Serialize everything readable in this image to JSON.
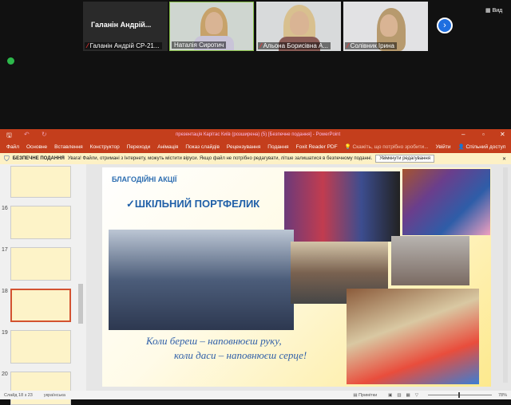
{
  "meeting": {
    "participants": [
      {
        "tile_name": "Галанін Андрій...",
        "label": "Галанін Андрій СР-21..."
      },
      {
        "label": "Наталія Сиротич"
      },
      {
        "label": "Альона Борисівна А..."
      },
      {
        "label": "Солівник Ірина"
      }
    ],
    "view_label": "Вид"
  },
  "powerpoint": {
    "title": "презентація Карітас Київ (розширена) (5) [Безпечне подання] - PowerPoint",
    "tabs": [
      "Файл",
      "Основне",
      "Вставлення",
      "Конструктор",
      "Переходи",
      "Анімація",
      "Показ слайдів",
      "Рецензування",
      "Подання",
      "Foxit Reader PDF"
    ],
    "tell_me": "Скажіть, що потрібно зробити...",
    "signin": "Увійти",
    "share": "Спільний доступ",
    "protected_view": {
      "label": "БЕЗПЕЧНЕ ПОДАННЯ",
      "message": "Увага! Файли, отримані з Інтернету, можуть містити віруси. Якщо файл не потрібно редагувати, літше залишатися в безпечному поданні.",
      "button": "Увімкнути редагування"
    },
    "thumbnails": [
      "16",
      "17",
      "18",
      "19",
      "20"
    ],
    "selected_slide": "18",
    "slide": {
      "heading": "БЛАГОДІЙНІ АКЦІЇ",
      "subtitle": "✓ШКІЛЬНИЙ ПОРТФЕЛИК",
      "quote_line1": "Коли береш – наповнюєш руку,",
      "quote_line2": "коли даси – наповнюєш серце!"
    },
    "status": {
      "slide_count": "Слайд 18 з 23",
      "language": "українська",
      "notes": "Примітки",
      "zoom": "78%"
    }
  }
}
